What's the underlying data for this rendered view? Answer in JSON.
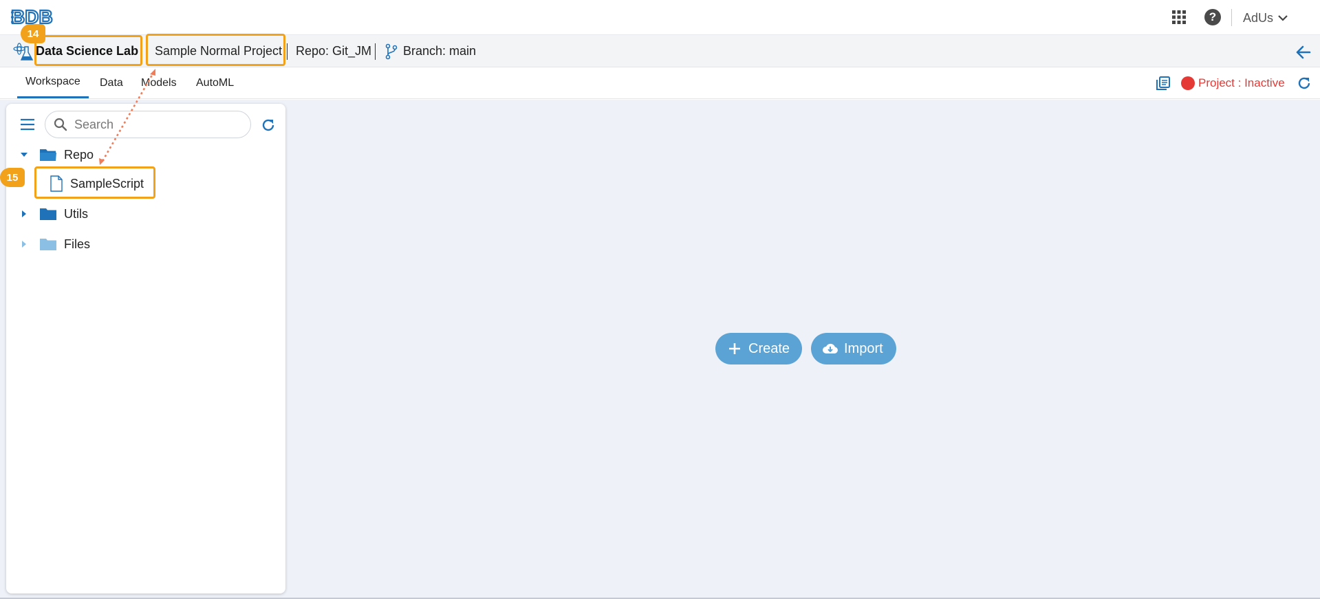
{
  "header": {
    "logo": "BDB",
    "user": "AdUs"
  },
  "breadcrumb": {
    "app_name": "Data Science Lab",
    "project": "Sample Normal Project",
    "repo": "Repo: Git_JM",
    "branch": "Branch: main"
  },
  "tabs": [
    {
      "label": "Workspace",
      "active": true
    },
    {
      "label": "Data",
      "active": false
    },
    {
      "label": "Models",
      "active": false
    },
    {
      "label": "AutoML",
      "active": false
    }
  ],
  "project_status": {
    "label": "Project : Inactive",
    "color": "#e53935"
  },
  "sidebar": {
    "search": {
      "placeholder": "Search",
      "value": ""
    },
    "tree": [
      {
        "label": "Repo",
        "expanded": true,
        "icon": "folder-open-icon",
        "children": [
          {
            "label": "SampleScript",
            "icon": "file-icon"
          }
        ]
      },
      {
        "label": "Utils",
        "expanded": false,
        "icon": "folder-icon"
      },
      {
        "label": "Files",
        "expanded": false,
        "icon": "folder-icon"
      }
    ]
  },
  "actions": {
    "create_label": "Create",
    "import_label": "Import"
  },
  "callouts": [
    {
      "number": "14"
    },
    {
      "number": "15"
    }
  ],
  "colors": {
    "accent": "#1f72b8",
    "callout": "#f2a21a",
    "button": "#5aa3d4",
    "background": "#eef1f8"
  }
}
